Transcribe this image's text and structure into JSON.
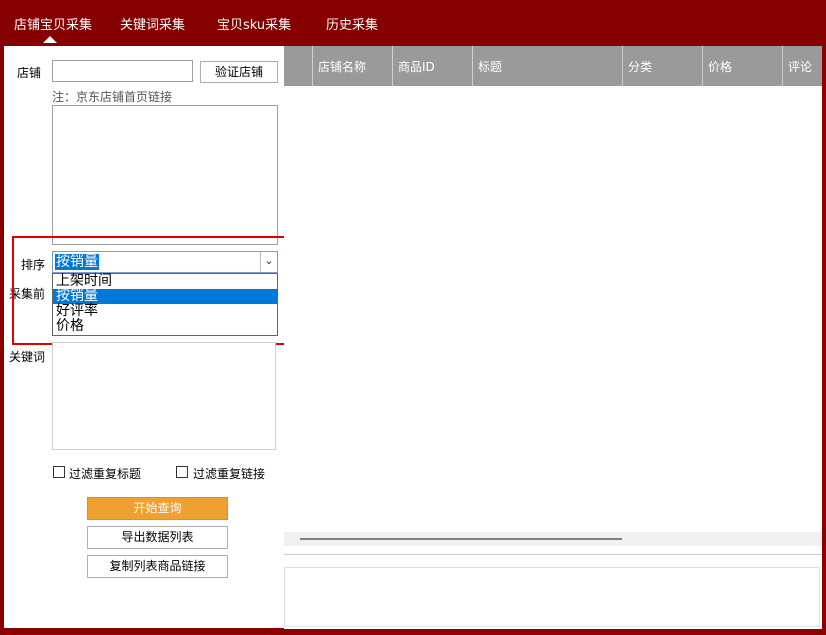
{
  "tabs": [
    "店铺宝贝采集",
    "关键词采集",
    "宝贝sku采集",
    "历史采集"
  ],
  "form": {
    "shop_label": "店铺",
    "shop_value": "",
    "verify_button": "验证店铺",
    "shop_note": "注：京东店铺首页链接",
    "sort_label": "排序",
    "sort_selected": "按销量",
    "sort_options": [
      "上架时间",
      "按销量",
      "好评率",
      "价格"
    ],
    "collect_before_label": "采集前",
    "keyword_label": "关键词",
    "filter_title_label": "过滤重复标题",
    "filter_link_label": "过滤重复链接",
    "start_button": "开始查询",
    "export_button": "导出数据列表",
    "copy_button": "复制列表商品链接"
  },
  "table": {
    "columns": [
      "店铺名称",
      "商品ID",
      "标题",
      "分类",
      "价格",
      "评论"
    ]
  },
  "colors": {
    "frame": "#8b0000",
    "accent_orange": "#f0a030",
    "selection_blue": "#0078d7",
    "highlight_red": "#e00000",
    "header_gray": "#9a9a9a"
  }
}
